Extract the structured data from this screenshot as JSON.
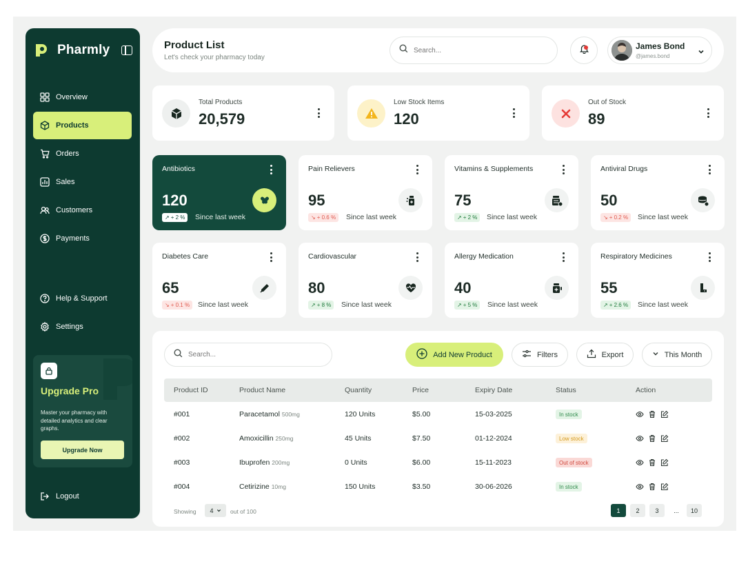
{
  "brand": {
    "name": "Pharmly"
  },
  "sidebar": {
    "items": [
      {
        "label": "Overview",
        "icon": "grid-icon"
      },
      {
        "label": "Products",
        "icon": "box-icon",
        "active": true
      },
      {
        "label": "Orders",
        "icon": "cart-icon"
      },
      {
        "label": "Sales",
        "icon": "chart-icon"
      },
      {
        "label": "Customers",
        "icon": "users-icon"
      },
      {
        "label": "Payments",
        "icon": "dollar-icon"
      },
      {
        "label": "Help & Support",
        "icon": "help-icon"
      },
      {
        "label": "Settings",
        "icon": "gear-icon"
      }
    ],
    "promo": {
      "title": "Upgrade Pro",
      "text": "Master your pharmacy with detailed analytics and clear graphs.",
      "button": "Upgrade Now"
    },
    "logout": "Logout"
  },
  "header": {
    "title": "Product List",
    "subtitle": "Let's check your pharmacy today",
    "search_placeholder": "Search...",
    "user": {
      "name": "James Bond",
      "handle": "@james.bond"
    }
  },
  "stats": [
    {
      "label": "Total Products",
      "value": "20,579",
      "icon": "cube-icon"
    },
    {
      "label": "Low Stock Items",
      "value": "120",
      "icon": "warning-icon"
    },
    {
      "label": "Out of Stock",
      "value": "89",
      "icon": "x-icon"
    }
  ],
  "categories": [
    {
      "name": "Antibiotics",
      "value": "120",
      "change": "+ 2 %",
      "trend": "up",
      "since": "Since last week"
    },
    {
      "name": "Pain Relievers",
      "value": "95",
      "change": "+ 0.6 %",
      "trend": "down",
      "since": "Since last week"
    },
    {
      "name": "Vitamins & Supplements",
      "value": "75",
      "change": "+ 2 %",
      "trend": "up",
      "since": "Since last week"
    },
    {
      "name": "Antiviral Drugs",
      "value": "50",
      "change": "+ 0.2 %",
      "trend": "down",
      "since": "Since last week"
    },
    {
      "name": "Diabetes Care",
      "value": "65",
      "change": "+ 0.1 %",
      "trend": "down",
      "since": "Since last week"
    },
    {
      "name": "Cardiovascular",
      "value": "80",
      "change": "+ 8 %",
      "trend": "up",
      "since": "Since last week"
    },
    {
      "name": "Allergy Medication",
      "value": "40",
      "change": "+ 5 %",
      "trend": "up",
      "since": "Since last week"
    },
    {
      "name": "Respiratory Medicines",
      "value": "55",
      "change": "+ 2.6 %",
      "trend": "up",
      "since": "Since last week"
    }
  ],
  "table": {
    "search_placeholder": "Search...",
    "add_button": "Add New Product",
    "filters_button": "Filters",
    "export_button": "Export",
    "period": "This Month",
    "headers": [
      "Product ID",
      "Product Name",
      "Quantity",
      "Price",
      "Expiry Date",
      "Status",
      "Action"
    ],
    "rows": [
      {
        "id": "#001",
        "name": "Paracetamol",
        "dose": "500mg",
        "qty": "120 Units",
        "price": "$5.00",
        "expiry": "15-03-2025",
        "status": "In stock",
        "status_type": "in"
      },
      {
        "id": "#002",
        "name": "Amoxicillin",
        "dose": "250mg",
        "qty": "45 Units",
        "price": "$7.50",
        "expiry": "01-12-2024",
        "status": "Low stock",
        "status_type": "low"
      },
      {
        "id": "#003",
        "name": "Ibuprofen",
        "dose": "200mg",
        "qty": "0 Units",
        "price": "$6.00",
        "expiry": "15-11-2023",
        "status": "Out of stock",
        "status_type": "out"
      },
      {
        "id": "#004",
        "name": "Cetirizine",
        "dose": "10mg",
        "qty": "150 Units",
        "price": "$3.50",
        "expiry": "30-06-2026",
        "status": "In stock",
        "status_type": "in"
      }
    ],
    "footer": {
      "showing": "Showing",
      "per_page": "4",
      "out_of": "out of 100",
      "pages": [
        "1",
        "2",
        "3",
        "...",
        "10"
      ]
    }
  },
  "colors": {
    "sidebar": "#0d3a30",
    "accent": "#d8ef7a",
    "dark_card": "#134a3c"
  }
}
